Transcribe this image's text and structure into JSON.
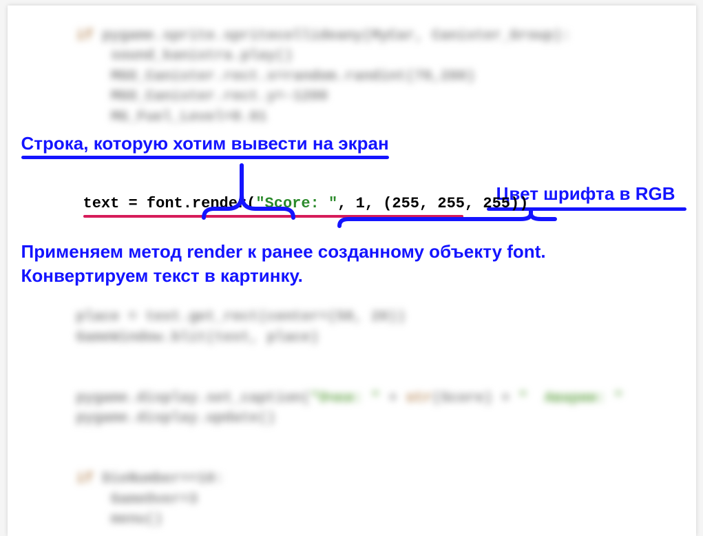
{
  "blurred_code_top": {
    "kw": "if",
    "line1_rest": " pygame.sprite.spritecollideany(MyCar, Canister_Group):",
    "line2": "    sound_kanistra.play()",
    "line3": "    MGO_Canister.rect.x=random.randint(70,280)",
    "line4": "    MGO_Canister.rect.y=-1200",
    "line5": "    MG_Fuel_Level=0.01"
  },
  "annotation1": "Строка, которую хотим вывести на экран",
  "annotation2": "Цвет шрифта в RGB",
  "code_line": {
    "prefix": "text = font.render(",
    "string": "\"Score: \"",
    "middle": ", 1, (255, 255, 255))"
  },
  "annotation3_line1": "Применяем метод render к ранее созданному объекту font.",
  "annotation3_line2": "Конвертируем текст в картинку.",
  "blurred_code_bottom": {
    "line1": "place = text.get_rect(center=(50, 20))",
    "line2": "GameWindow.blit(text, place)",
    "line3a": "pygame.display.set_caption(",
    "line3_str1": "\"Очки: \"",
    "line3b": " + ",
    "line3_fn": "str",
    "line3c": "(Score) + ",
    "line3_str2": "\"  Аварии: \"",
    "line4": "pygame.display.update()",
    "line5_kw": "if",
    "line5_rest": " DieNumber==10:",
    "line6": "    GameOver=3",
    "line7": "    menu()"
  }
}
